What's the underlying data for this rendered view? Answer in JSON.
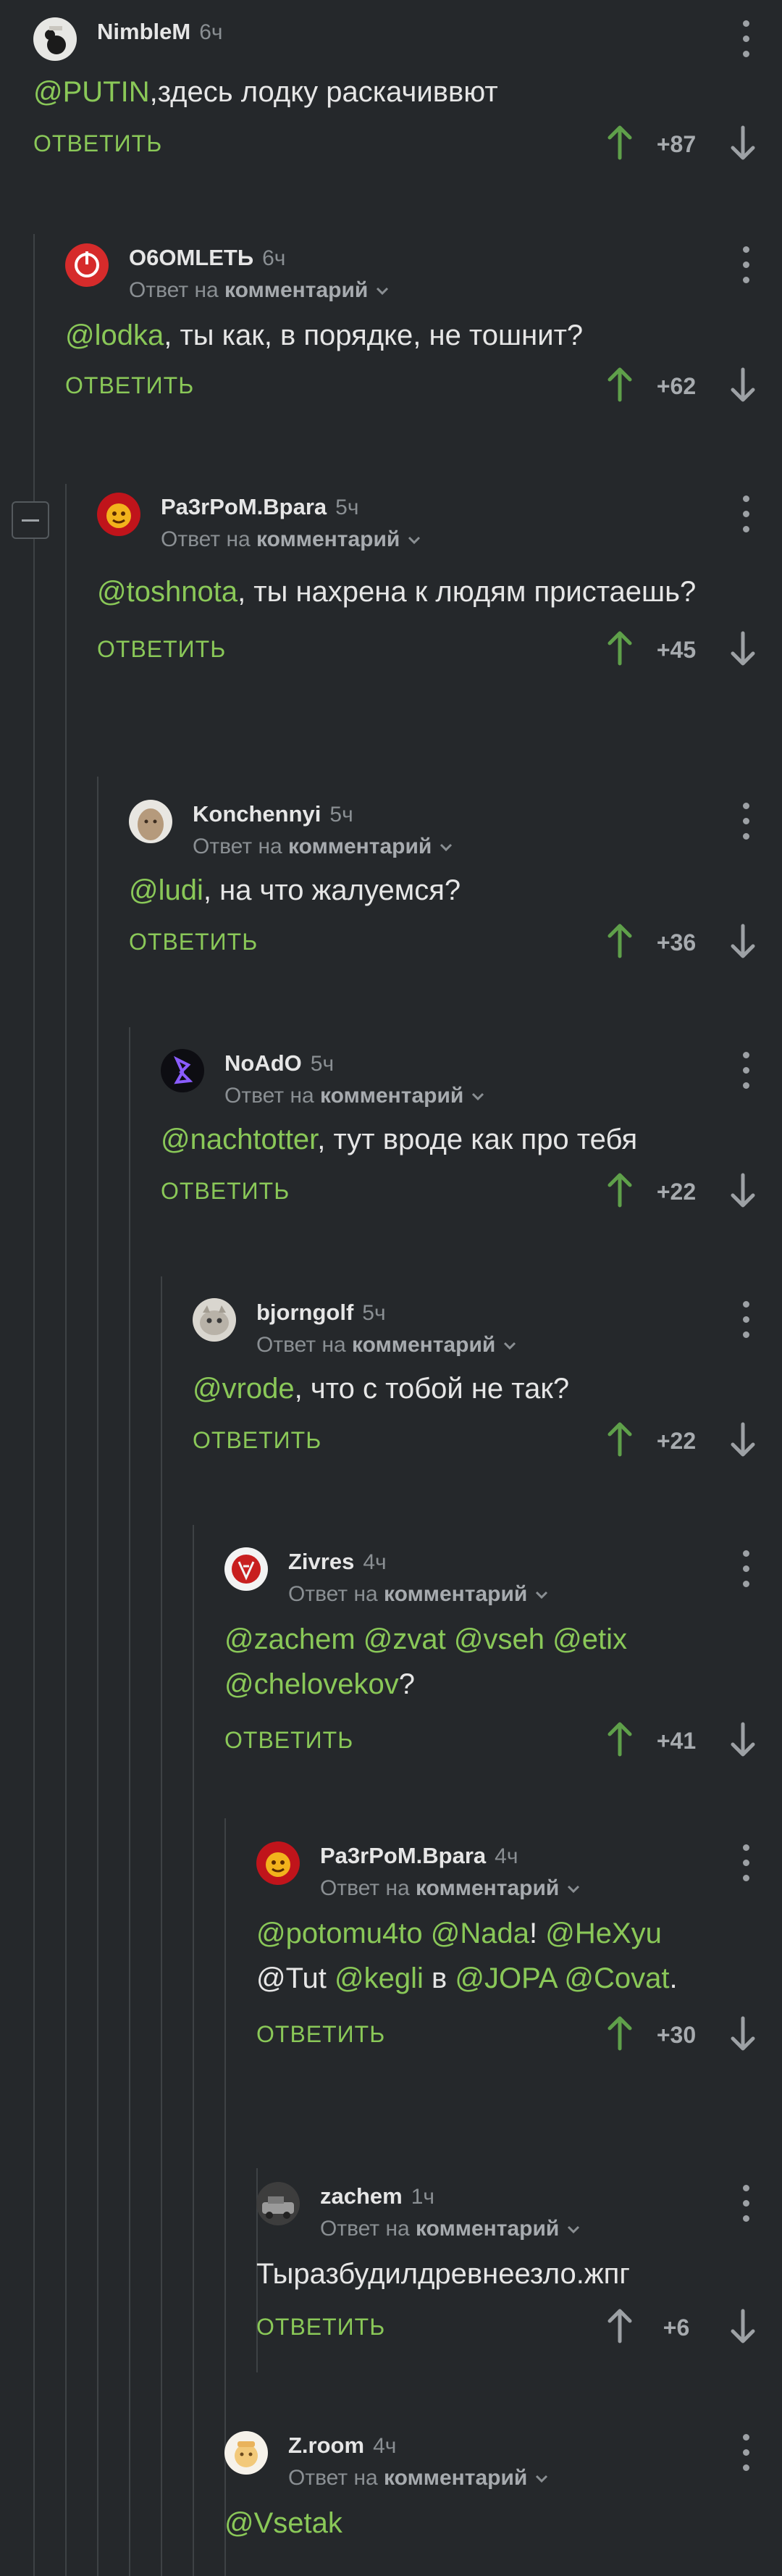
{
  "comments": [
    {
      "author": "NimbleM",
      "time": "6ч",
      "reply_prefix": "",
      "reply_target": "",
      "text_segments": [
        {
          "t": "@PUTIN",
          "m": true
        },
        {
          "t": ",здесь лодку раскачиввют",
          "m": false
        }
      ],
      "reply_label": "ответить",
      "score": "+87",
      "upvoted": true
    },
    {
      "author": "O6OMLETЬ",
      "time": "6ч",
      "reply_prefix": "Ответ на",
      "reply_target": "комментарий",
      "text_segments": [
        {
          "t": "@lodka",
          "m": true
        },
        {
          "t": ", ты как, в порядке, не тошнит?",
          "m": false
        }
      ],
      "reply_label": "ответить",
      "score": "+62",
      "upvoted": true
    },
    {
      "author": "Pa3rPoM.Bpara",
      "time": "5ч",
      "reply_prefix": "Ответ на",
      "reply_target": "комментарий",
      "text_segments": [
        {
          "t": "@toshnota",
          "m": true
        },
        {
          "t": ", ты нахрена к людям пристаешь?",
          "m": false
        }
      ],
      "reply_label": "ответить",
      "score": "+45",
      "upvoted": true
    },
    {
      "author": "Konchennyi",
      "time": "5ч",
      "reply_prefix": "Ответ на",
      "reply_target": "комментарий",
      "text_segments": [
        {
          "t": "@ludi",
          "m": true
        },
        {
          "t": ", на что жалуемся?",
          "m": false
        }
      ],
      "reply_label": "ответить",
      "score": "+36",
      "upvoted": true
    },
    {
      "author": "NoAdO",
      "time": "5ч",
      "reply_prefix": "Ответ на",
      "reply_target": "комментарий",
      "text_segments": [
        {
          "t": "@nachtotter",
          "m": true
        },
        {
          "t": ", тут вроде как про тебя",
          "m": false
        }
      ],
      "reply_label": "ответить",
      "score": "+22",
      "upvoted": true
    },
    {
      "author": "bjorngolf",
      "time": "5ч",
      "reply_prefix": "Ответ на",
      "reply_target": "комментарий",
      "text_segments": [
        {
          "t": "@vrode",
          "m": true
        },
        {
          "t": ", что с тобой не так?",
          "m": false
        }
      ],
      "reply_label": "ответить",
      "score": "+22",
      "upvoted": true
    },
    {
      "author": "Zivres",
      "time": "4ч",
      "reply_prefix": "Ответ на",
      "reply_target": "комментарий",
      "text_segments": [
        {
          "t": "@zachem",
          "m": true
        },
        {
          "t": " ",
          "m": false
        },
        {
          "t": "@zvat",
          "m": true
        },
        {
          "t": " ",
          "m": false
        },
        {
          "t": "@vseh",
          "m": true
        },
        {
          "t": " ",
          "m": false
        },
        {
          "t": "@etix",
          "m": true
        },
        {
          "t": " ",
          "m": false
        },
        {
          "t": "@chelovekov",
          "m": true
        },
        {
          "t": "?",
          "m": false
        }
      ],
      "reply_label": "ответить",
      "score": "+41",
      "upvoted": true
    },
    {
      "author": "Pa3rPoM.Bpara",
      "time": "4ч",
      "reply_prefix": "Ответ на",
      "reply_target": "комментарий",
      "text_segments": [
        {
          "t": "@potomu4to",
          "m": true
        },
        {
          "t": " ",
          "m": false
        },
        {
          "t": "@Nada",
          "m": true
        },
        {
          "t": "! ",
          "m": false
        },
        {
          "t": "@HeXyu",
          "m": true
        },
        {
          "t": " @Tut ",
          "m": false
        },
        {
          "t": "@kegli",
          "m": true
        },
        {
          "t": " в ",
          "m": false
        },
        {
          "t": "@JOPA",
          "m": true
        },
        {
          "t": " ",
          "m": false
        },
        {
          "t": "@Covat",
          "m": true
        },
        {
          "t": ".",
          "m": false
        }
      ],
      "reply_label": "ответить",
      "score": "+30",
      "upvoted": true
    },
    {
      "author": "zachem",
      "time": "1ч",
      "reply_prefix": "Ответ на",
      "reply_target": "комментарий",
      "text_segments": [
        {
          "t": "Тыразбудилдревнеезло.жпг",
          "m": false
        }
      ],
      "reply_label": "ответить",
      "score": "+6",
      "upvoted": false
    },
    {
      "author": "Z.room",
      "time": "4ч",
      "reply_prefix": "Ответ на",
      "reply_target": "комментарий",
      "text_segments": [
        {
          "t": "@Vsetak",
          "m": true
        }
      ],
      "reply_label": "",
      "score": "",
      "upvoted": false
    }
  ],
  "colors": {
    "background": "#25282b",
    "text": "#e6e6e6",
    "muted": "#8a8f93",
    "accent_green": "#8ac858",
    "upvote_green": "#5fa04a",
    "thread_line": "#3e4245"
  },
  "icons": {
    "upvote": "arrow-up-icon",
    "downvote": "arrow-down-icon",
    "menu": "kebab-menu-icon",
    "collapse": "collapse-minus-icon",
    "reply_chevron": "chevron-down-icon"
  }
}
